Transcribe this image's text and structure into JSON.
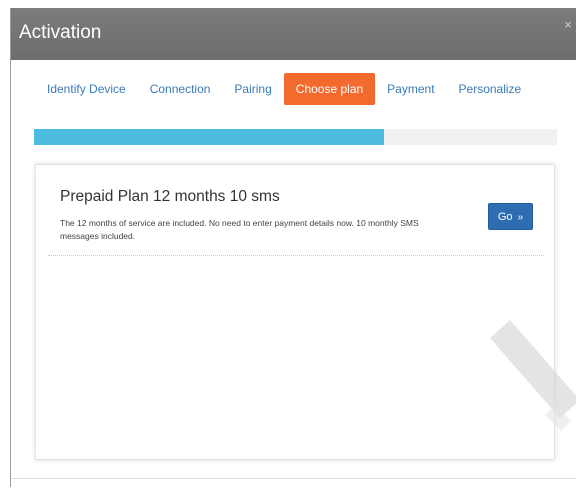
{
  "dialog": {
    "title": "Activation",
    "close_label": "×"
  },
  "steps": [
    {
      "label": "Identify Device",
      "active": false
    },
    {
      "label": "Connection",
      "active": false
    },
    {
      "label": "Pairing",
      "active": false
    },
    {
      "label": "Choose plan",
      "active": true
    },
    {
      "label": "Payment",
      "active": false
    },
    {
      "label": "Personalize",
      "active": false
    }
  ],
  "progress": {
    "fraction": 0.67,
    "fill_color": "#4cbbe0"
  },
  "plans": [
    {
      "title": "Prepaid Plan 12 months 10 sms",
      "description": "The 12 months of service are included. No need to enter payment details now. 10 monthly SMS messages included.",
      "button_label": "Go",
      "button_icon": "double-chevron-right-icon"
    }
  ],
  "colors": {
    "header": "#727272",
    "active_step": "#f26a2e",
    "step_link": "#3a79b7",
    "button": "#2f6db3"
  }
}
